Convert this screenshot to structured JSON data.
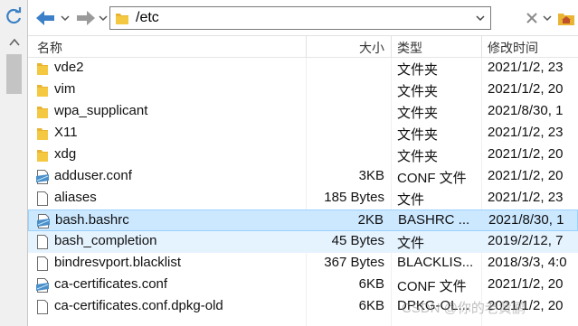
{
  "address": {
    "path": "/etc"
  },
  "header": {
    "name": "名称",
    "size": "大小",
    "type": "类型",
    "modified": "修改时间"
  },
  "rows": [
    {
      "name": "vde2",
      "size": "",
      "type": "文件夹",
      "modified": "2021/1/2, 23",
      "icon": "folder-icon",
      "state": ""
    },
    {
      "name": "vim",
      "size": "",
      "type": "文件夹",
      "modified": "2021/1/2, 20",
      "icon": "folder-icon",
      "state": ""
    },
    {
      "name": "wpa_supplicant",
      "size": "",
      "type": "文件夹",
      "modified": "2021/8/30, 1",
      "icon": "folder-icon",
      "state": ""
    },
    {
      "name": "X11",
      "size": "",
      "type": "文件夹",
      "modified": "2021/1/2, 23",
      "icon": "folder-icon",
      "state": ""
    },
    {
      "name": "xdg",
      "size": "",
      "type": "文件夹",
      "modified": "2021/1/2, 20",
      "icon": "folder-icon",
      "state": ""
    },
    {
      "name": "adduser.conf",
      "size": "3KB",
      "type": "CONF 文件",
      "modified": "2021/1/2, 20",
      "icon": "config-file-icon",
      "state": ""
    },
    {
      "name": "aliases",
      "size": "185 Bytes",
      "type": "文件",
      "modified": "2021/1/2, 23",
      "icon": "file-icon",
      "state": ""
    },
    {
      "name": "bash.bashrc",
      "size": "2KB",
      "type": "BASHRC ...",
      "modified": "2021/8/30, 1",
      "icon": "config-file-icon",
      "state": "selected"
    },
    {
      "name": "bash_completion",
      "size": "45 Bytes",
      "type": "文件",
      "modified": "2019/2/12, 7",
      "icon": "file-icon",
      "state": "hover"
    },
    {
      "name": "bindresvport.blacklist",
      "size": "367 Bytes",
      "type": "BLACKLIS...",
      "modified": "2018/3/3, 4:0",
      "icon": "file-icon",
      "state": ""
    },
    {
      "name": "ca-certificates.conf",
      "size": "6KB",
      "type": "CONF 文件",
      "modified": "2021/1/2, 20",
      "icon": "config-file-icon",
      "state": ""
    },
    {
      "name": "ca-certificates.conf.dpkg-old",
      "size": "6KB",
      "type": "DPKG-OL...",
      "modified": "2021/1/2, 20",
      "icon": "file-icon",
      "state": ""
    }
  ],
  "watermark": "CSDN @你的老黄鹂"
}
